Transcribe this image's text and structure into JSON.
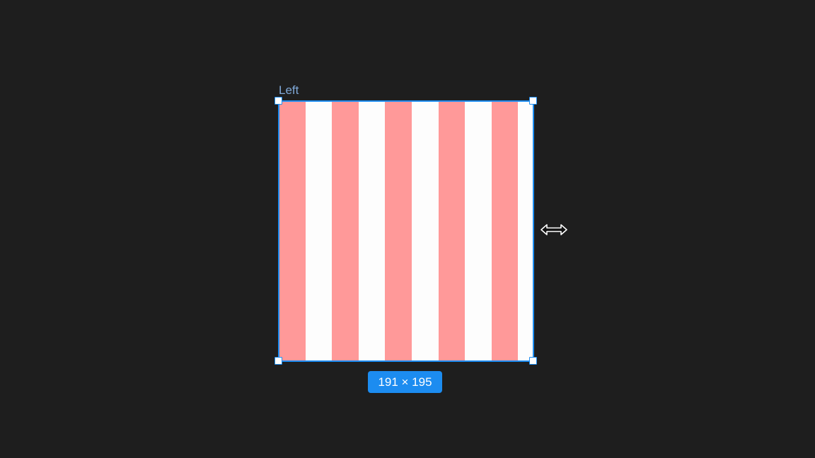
{
  "frame": {
    "label": "Left",
    "size_badge": "191 × 195",
    "stripe_colors": {
      "pink": "#ff9999",
      "white": "#fdfdfd"
    }
  },
  "selection": {
    "accent_color": "#1c8cf0"
  },
  "cursor": {
    "icon": "horizontal-resize-icon"
  }
}
